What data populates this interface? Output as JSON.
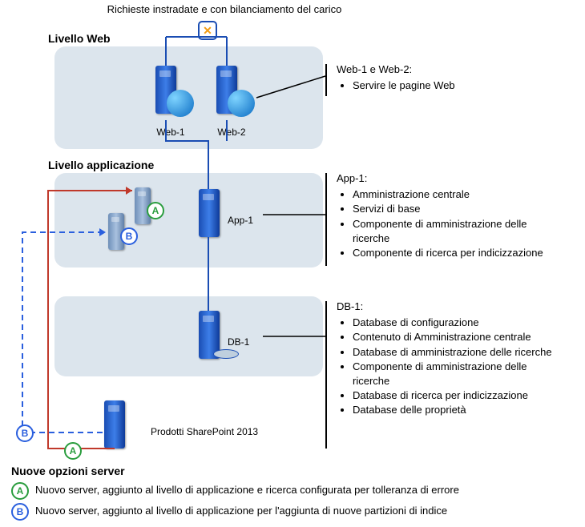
{
  "header": {
    "routing": "Richieste instradate e con bilanciamento del carico"
  },
  "tiers": {
    "web": {
      "label": "Livello Web",
      "srv1": "Web-1",
      "srv2": "Web-2"
    },
    "app": {
      "label": "Livello applicazione",
      "srv1": "App-1"
    },
    "db": {
      "srv1": "DB-1"
    }
  },
  "descriptions": {
    "web": {
      "title": "Web-1 e Web-2:",
      "items": [
        "Servire le pagine Web"
      ]
    },
    "app": {
      "title": "App-1:",
      "items": [
        "Amministrazione centrale",
        "Servizi di base",
        "Componente di amministrazione delle ricerche",
        "Componente di ricerca per indicizzazione"
      ]
    },
    "db": {
      "title": "DB-1:",
      "items": [
        "Database di configurazione",
        "Contenuto di Amministrazione centrale",
        "Database di amministrazione delle ricerche",
        "Componente di amministrazione delle ricerche",
        "Database di ricerca per indicizzazione",
        "Database delle proprietà"
      ]
    }
  },
  "new_servers": {
    "heading": "Nuove opzioni server",
    "product": "Prodotti SharePoint 2013",
    "a_badge": "A",
    "b_badge": "B",
    "a_text": "Nuovo server, aggiunto al livello di applicazione e ricerca configurata per tolleranza di errore",
    "b_text": "Nuovo server, aggiunto al livello di applicazione per l'aggiunta di nuove partizioni di indice"
  }
}
